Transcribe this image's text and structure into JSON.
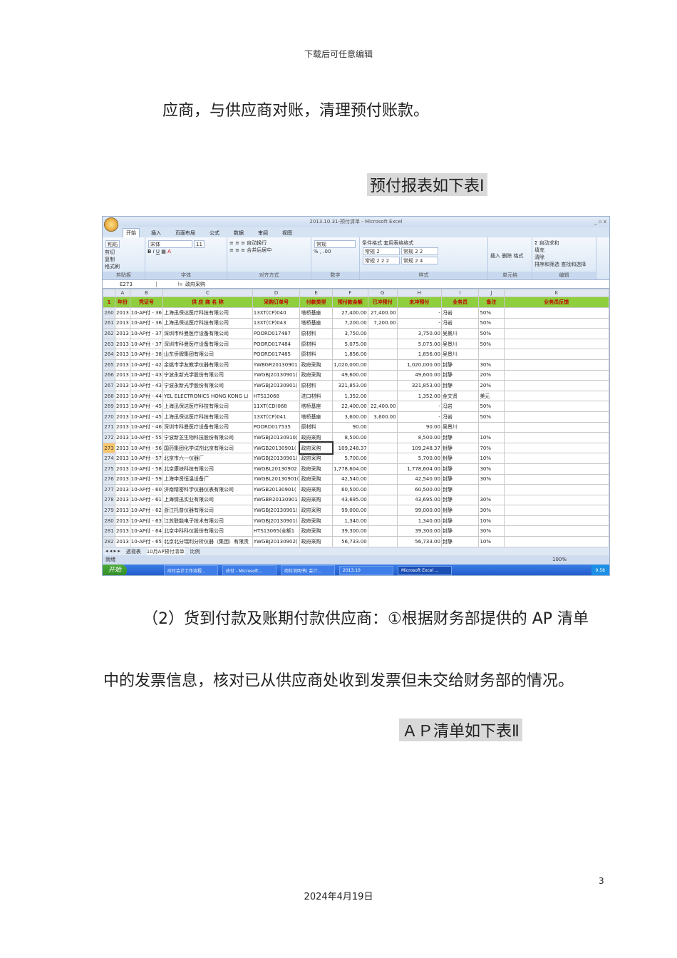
{
  "header": "下载后可任意编辑",
  "paragraphs": {
    "p1": "应商，与供应商对账，清理预付账款。",
    "caption1": "预付报表如下表Ⅰ",
    "p2": "（2）货到付款及账期付款供应商：①根据财务部提供的 AP 清单",
    "p3": "中的发票信息，核对已从供应商处收到发票但未交给财务部的情况。",
    "caption2": "ＡＰ清单如下表Ⅱ"
  },
  "page_number": "3",
  "date": "2024年4月19日",
  "excel": {
    "title": "2013.10.31-预付清单 - Microsoft Excel",
    "tabs": [
      "开始",
      "插入",
      "页面布局",
      "公式",
      "数据",
      "审阅",
      "视图"
    ],
    "ribbon": {
      "clipboard": {
        "paste": "粘贴",
        "cut": "剪切",
        "copy": "复制",
        "format_painter": "格式刷",
        "label": "剪贴板"
      },
      "font": {
        "name": "宋体",
        "size": "11",
        "label": "字体"
      },
      "alignment": {
        "wrap": "自动换行",
        "merge": "合并后居中",
        "label": "对齐方式"
      },
      "number": {
        "format": "常规",
        "label": "数字"
      },
      "styles": {
        "cond": "条件格式",
        "table": "套用表格格式",
        "cells": [
          "常规 2",
          "常规 2 2",
          "常规 2 2 2",
          "常规 2 4"
        ],
        "label": "样式"
      },
      "cells": {
        "insert": "插入",
        "delete": "删除",
        "format": "格式",
        "label": "单元格"
      },
      "editing": {
        "autosum": "自动求和",
        "fill": "填充",
        "clear": "清除",
        "sort": "排序和筛选",
        "find": "查找和选择",
        "label": "编辑"
      }
    },
    "name_box": "E273",
    "formula": "政府采购",
    "columns": [
      "A",
      "B",
      "C",
      "D",
      "E",
      "F",
      "G",
      "H",
      "I",
      "J",
      "K"
    ],
    "headers": [
      "年份",
      "凭证号",
      "供 应 商 名 称",
      "采购订单号",
      "付款类型",
      "预付款金额",
      "已冲预付",
      "未冲预付",
      "业务员",
      "备注",
      "业务员反馈"
    ],
    "rows": [
      [
        "260",
        "2013",
        "10-AP付 - 36",
        "上海迅保达医疗科技有限公司",
        "13XT(CP)040",
        "塔桥基座",
        "27,400.00",
        "27,400.00",
        "-",
        "冯岩",
        "50%"
      ],
      [
        "261",
        "2013",
        "10-AP付 - 36",
        "上海迅保达医疗科技有限公司",
        "13XT(CP)043",
        "塔桥基座",
        "7,200.00",
        "7,200.00",
        "-",
        "冯岩",
        "50%"
      ],
      [
        "262",
        "2013",
        "10-AP付 - 37",
        "深圳市科曼医疗设备有限公司",
        "POORD017487",
        "原材料",
        "3,750.00",
        "",
        "3,750.00",
        "吴景川",
        "50%"
      ],
      [
        "263",
        "2013",
        "10-AP付 - 37",
        "深圳市科曼医疗设备有限公司",
        "POORD017484",
        "原材料",
        "5,075.00",
        "",
        "5,075.00",
        "吴景川",
        "50%"
      ],
      [
        "264",
        "2013",
        "10-AP付 - 38",
        "山东侨牌集团有限公司",
        "POORD017485",
        "原材料",
        "1,856.00",
        "",
        "1,856.00",
        "吴景川",
        ""
      ],
      [
        "265",
        "2013",
        "10-AP付 - 42",
        "余姚市学友教学仪器有限公司",
        "YWBGR20130901",
        "政府采购",
        "1,020,000.00",
        "",
        "1,020,000.00",
        "封静",
        "30%"
      ],
      [
        "266",
        "2013",
        "10-AP付 - 43",
        "宁波永新光学股份有限公司",
        "YWGBJ20130901(",
        "政府采购",
        "49,600.00",
        "",
        "49,600.00",
        "封静",
        "20%"
      ],
      [
        "267",
        "2013",
        "10-AP付 - 43",
        "宁波永新光学股份有限公司",
        "YWGBJ20130901(",
        "原材料",
        "321,853.00",
        "",
        "321,853.00",
        "封静",
        "20%"
      ],
      [
        "268",
        "2013",
        "10-AP付 - 44",
        "YEL ELECTRONICS HONG KONG LI",
        "HTS13068",
        "进口材料",
        "1,352.00",
        "",
        "1,352.00",
        "金文贤",
        "美元"
      ],
      [
        "269",
        "2013",
        "10-AP付 - 45",
        "上海迅保达医疗科技有限公司",
        "11XT(CD)068",
        "塔桥基座",
        "22,400.00",
        "22,400.00",
        "-",
        "冯岩",
        "50%"
      ],
      [
        "270",
        "2013",
        "10-AP付 - 45",
        "上海迅保达医疗科技有限公司",
        "13XT(CP)041",
        "塔桥基座",
        "3,600.00",
        "3,600.00",
        "-",
        "冯岩",
        "50%"
      ],
      [
        "271",
        "2013",
        "10-AP付 - 46",
        "深圳市科曼医疗设备有限公司",
        "POORD017535",
        "原材料",
        "90.00",
        "",
        "90.00",
        "吴景川",
        ""
      ],
      [
        "272",
        "2013",
        "10-AP付 - 55",
        "宁波新芝生物科技股份有限公司",
        "YWGBJ20130910(",
        "政府采购",
        "8,500.00",
        "",
        "8,500.00",
        "封静",
        "10%"
      ],
      [
        "273",
        "2013",
        "10-AP付 - 56",
        "国药集团化学试剂北京有限公司",
        "YWGB20130901(",
        "政府采购",
        "109,248.37",
        "",
        "109,248.37",
        "封静",
        "70%"
      ],
      [
        "274",
        "2013",
        "10-AP付 - 57",
        "北京市六一仪器厂",
        "YWGBJ20130901(",
        "政府采购",
        "5,700.00",
        "",
        "5,700.00",
        "封静",
        "10%"
      ],
      [
        "275",
        "2013",
        "10-AP付 - 58",
        "北京康袂科技有限公司",
        "YWGBL20130902",
        "政府采购",
        "1,778,604.00",
        "",
        "1,778,604.00",
        "封静",
        "30%"
      ],
      [
        "276",
        "2013",
        "10-AP付 - 59",
        "上海申贤恒温设备厂",
        "YWGBL20130901(",
        "政府采购",
        "42,540.00",
        "",
        "42,540.00",
        "封静",
        "30%"
      ],
      [
        "277",
        "2013",
        "10-AP付 - 60",
        "济南精密科学仪器仪表有限公司",
        "YWGB20130901(",
        "政府采购",
        "60,500.00",
        "",
        "60,500.00",
        "封静",
        ""
      ],
      [
        "278",
        "2013",
        "10-AP付 - 61",
        "上海情迅实业有限公司",
        "YWGBR20130901",
        "政府采购",
        "43,695.00",
        "",
        "43,695.00",
        "封静",
        "30%"
      ],
      [
        "279",
        "2013",
        "10-AP付 - 62",
        "浙江托普仪器有限公司",
        "YWGBJ20130901(",
        "政府采购",
        "99,000.00",
        "",
        "99,000.00",
        "封静",
        "30%"
      ],
      [
        "280",
        "2013",
        "10-AP付 - 63",
        "江苏联能电子技术有限公司",
        "YWGBJ20130901(",
        "政府采购",
        "1,340.00",
        "",
        "1,340.00",
        "封静",
        "10%"
      ],
      [
        "281",
        "2013",
        "10-AP付 - 64",
        "北京中科科仪股份有限公司",
        "HTS13065(全额1",
        "政府采购",
        "39,300.00",
        "",
        "39,300.00",
        "封静",
        "30%"
      ],
      [
        "282",
        "2013",
        "10-AP付 - 65",
        "北京北分瑞利分析仪器（集团）有限责",
        "YWGBJ20130902(",
        "政府采购",
        "56,733.00",
        "",
        "56,733.00",
        "封静",
        "10%"
      ]
    ],
    "selected_row": "273",
    "sheet_tabs": [
      "透视表",
      "10月AP预付清单",
      "比例"
    ],
    "status": "就绪",
    "zoom": "100%",
    "taskbar": {
      "start": "开始",
      "items": [
        "应付会计工作流程...",
        "应付 - Microsoft...",
        "岗位说明书( 会计...",
        "2013.10",
        "Microsoft Excel ..."
      ],
      "clock": "9:58"
    }
  }
}
